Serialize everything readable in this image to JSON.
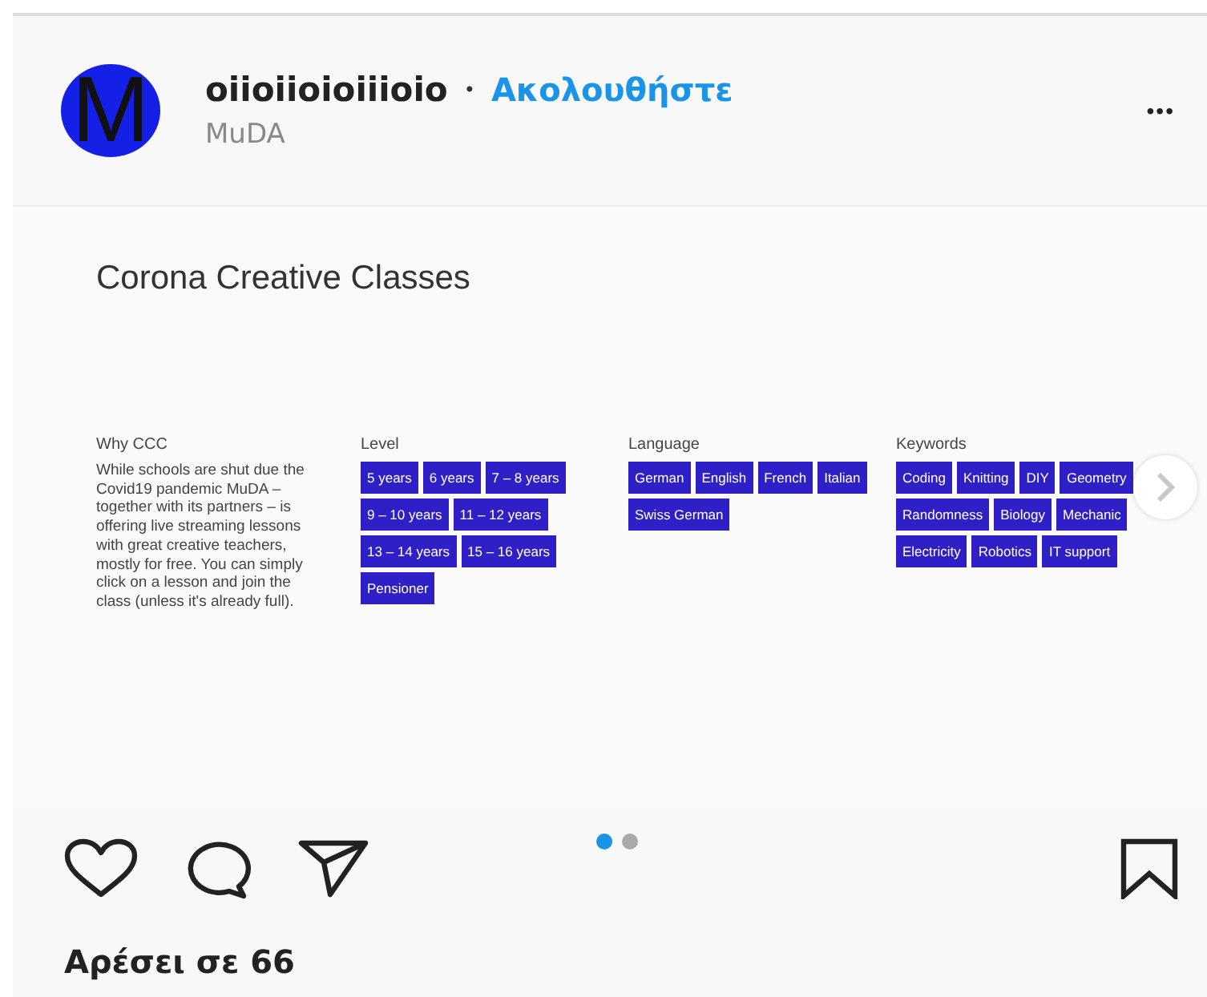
{
  "header": {
    "avatar_letter": "M",
    "username": "oiioiioioiiioio",
    "separator": "•",
    "follow": "Ακολουθήστε",
    "subtitle": "MuDA",
    "more": "•••"
  },
  "slide": {
    "title": "Corona Creative Classes",
    "intro": {
      "heading": "Why CCC",
      "text": "While schools are shut due the Covid19 pandemic MuDA – together with its partners – is offering live streaming lessons with great creative teachers, mostly for free. You can simply click on a lesson and join the class (unless it's already full)."
    },
    "groups": [
      {
        "heading": "Level",
        "tags": [
          "5 years",
          "6 years",
          "7 – 8 years",
          "9 – 10 years",
          "11 – 12 years",
          "13 – 14 years",
          "15 – 16 years",
          "Pensioner"
        ]
      },
      {
        "heading": "Language",
        "tags": [
          "German",
          "English",
          "French",
          "Italian",
          "Swiss German"
        ]
      },
      {
        "heading": "Keywords",
        "tags": [
          "Coding",
          "Knitting",
          "DIY",
          "Geometry",
          "Randomness",
          "Biology",
          "Mechanic",
          "Electricity",
          "Robotics",
          "IT support"
        ]
      }
    ]
  },
  "page_dots": [
    {
      "selected": true
    },
    {
      "selected": false
    }
  ],
  "likes": "Αρέσει σε 66"
}
